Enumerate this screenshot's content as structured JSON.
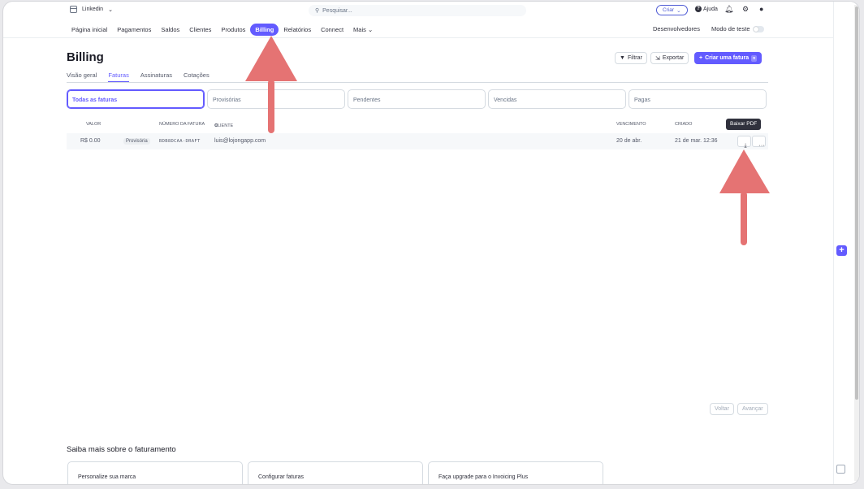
{
  "topbar": {
    "account_name": "Linkedin",
    "search_placeholder": "Pesquisar...",
    "create_label": "Criar",
    "help_label": "Ajuda"
  },
  "nav": {
    "items": [
      "Página inicial",
      "Pagamentos",
      "Saldos",
      "Clientes",
      "Produtos",
      "Billing",
      "Relatórios",
      "Connect",
      "Mais"
    ],
    "active": "Billing",
    "developers_label": "Desenvolvedores",
    "test_mode_label": "Modo de teste"
  },
  "page": {
    "title": "Billing",
    "filter_label": "Filtrar",
    "export_label": "Exportar",
    "create_invoice_label": "Criar uma fatura",
    "create_invoice_shortcut": "n",
    "tabs": [
      "Visão geral",
      "Faturas",
      "Assinaturas",
      "Cotações"
    ],
    "active_tab": "Faturas"
  },
  "filters": [
    "Todas as faturas",
    "Provisórias",
    "Pendentes",
    "Vencidas",
    "Pagas"
  ],
  "table": {
    "headers": {
      "amount": "VALOR",
      "invoice_number": "NÚMERO DA FATURA",
      "customer": "CLIENTE",
      "due": "VENCIMENTO",
      "created": "CRIADO"
    },
    "rows": [
      {
        "amount": "R$ 0.00",
        "status": "Provisória",
        "invoice_number": "BDB8DCAA-DRAFT",
        "customer": "luis@lojongapp.com",
        "due": "20 de abr.",
        "created": "21 de mar. 12:36"
      }
    ],
    "tooltip": "Baixar PDF"
  },
  "pagination": {
    "prev_label": "Voltar",
    "next_label": "Avançar"
  },
  "learn": {
    "title": "Saiba mais sobre o faturamento",
    "cards": [
      "Personalize sua marca",
      "Configurar faturas",
      "Faça upgrade para o Invoicing Plus"
    ]
  },
  "colors": {
    "accent": "#635bff",
    "annotation_arrow": "#e57373"
  }
}
